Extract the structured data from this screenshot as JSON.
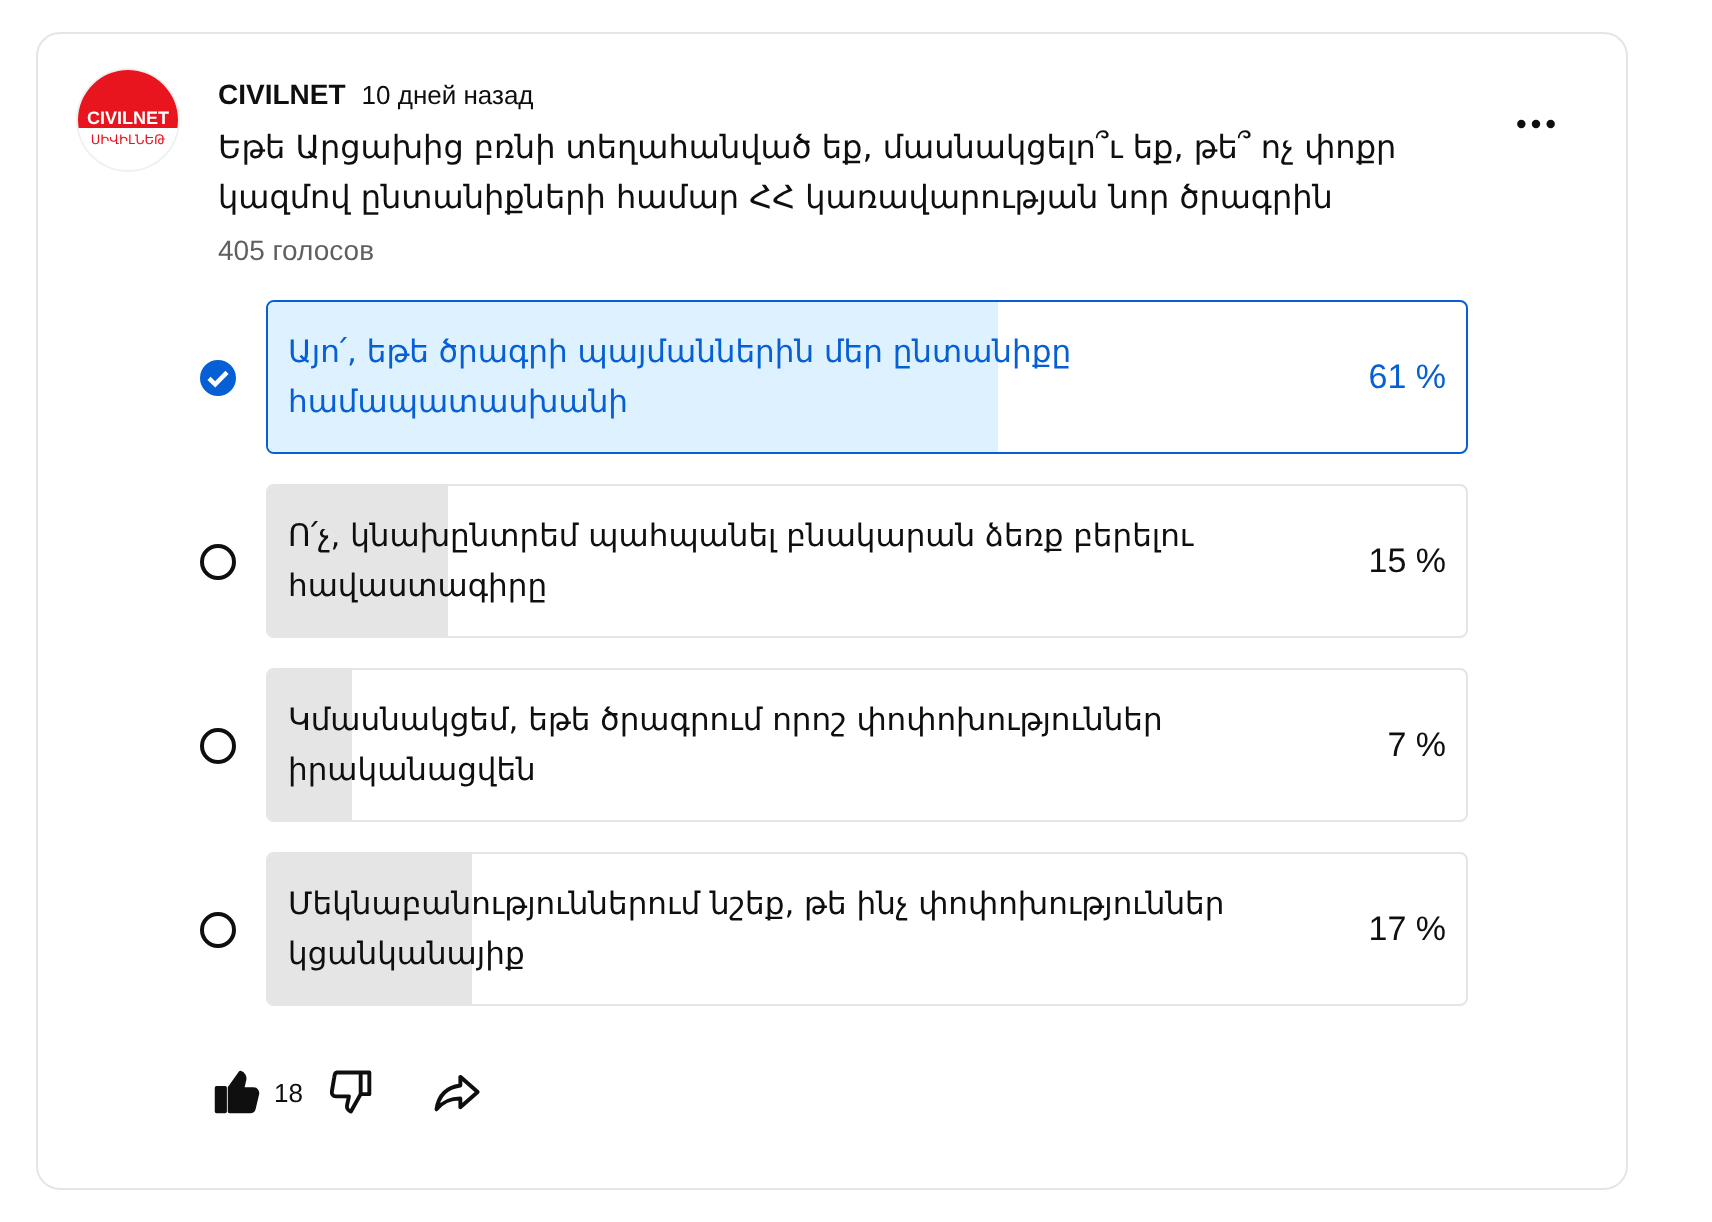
{
  "post": {
    "channel": "CIVILNET",
    "channel_logo": {
      "top": "CIVILNET",
      "bottom": "ՍԻՎԻԼՆԵԹ"
    },
    "time": "10 дней назад",
    "question": "Եթե Արցախից բռնի տեղահանված եք, մասնակցելո՞ւ եք, թե՞ ոչ փոքր կազմով ընտանիքների համար ՀՀ կառավարության նոր ծրագրին",
    "votes": "405 голосов"
  },
  "options": [
    {
      "text": "Այո՛, եթե ծրագրի պայմաններին մեր ընտանիքը համապատասխանի",
      "percent": "61 %",
      "level": 0.61,
      "selected": true
    },
    {
      "text": "Ո՛չ, կնախընտրեմ պահպանել բնակարան ձեռք բերելու հավաստագիրը",
      "percent": "15 %",
      "level": 0.15,
      "selected": false
    },
    {
      "text": "Կմասնակցեմ, եթե ծրագրում որոշ փոփոխություններ իրականացվեն",
      "percent": "7 %",
      "level": 0.07,
      "selected": false
    },
    {
      "text": "Մեկնաբանություններում նշեք, թե ինչ փոփոխություններ կցանկանայիք",
      "percent": "17 %",
      "level": 0.17,
      "selected": false
    }
  ],
  "actions": {
    "liked": true,
    "like_count": "18"
  }
}
